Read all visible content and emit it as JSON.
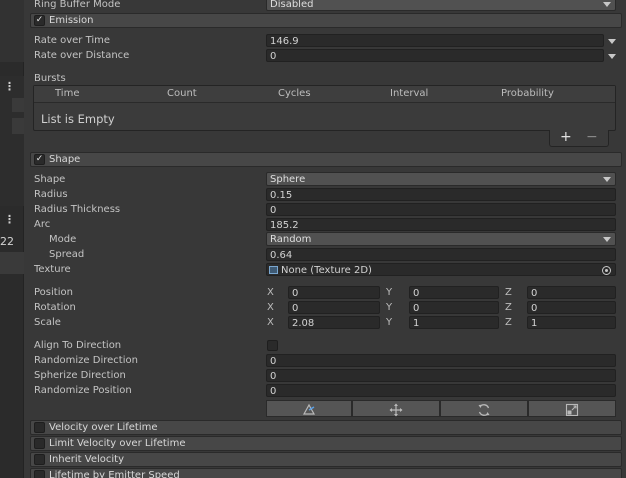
{
  "left_strip": {
    "counter_text": "22"
  },
  "ring_buffer": {
    "label": "Ring Buffer Mode",
    "value": "Disabled"
  },
  "emission": {
    "title": "Emission",
    "rate_over_time": {
      "label": "Rate over Time",
      "value": "146.9"
    },
    "rate_over_distance": {
      "label": "Rate over Distance",
      "value": "0"
    },
    "bursts": {
      "label": "Bursts",
      "columns": [
        "Time",
        "Count",
        "Cycles",
        "Interval",
        "Probability"
      ],
      "empty_text": "List is Empty",
      "add_label": "+",
      "remove_label": "−"
    }
  },
  "shape": {
    "title": "Shape",
    "shape": {
      "label": "Shape",
      "value": "Sphere"
    },
    "radius": {
      "label": "Radius",
      "value": "0.15"
    },
    "radius_thickness": {
      "label": "Radius Thickness",
      "value": "0"
    },
    "arc": {
      "label": "Arc",
      "value": "185.2"
    },
    "mode": {
      "label": "Mode",
      "value": "Random"
    },
    "spread": {
      "label": "Spread",
      "value": "0.64"
    },
    "texture": {
      "label": "Texture",
      "value": "None (Texture 2D)"
    },
    "position": {
      "label": "Position",
      "x": "0",
      "y": "0",
      "z": "0"
    },
    "rotation": {
      "label": "Rotation",
      "x": "0",
      "y": "0",
      "z": "0"
    },
    "scale": {
      "label": "Scale",
      "x": "2.08",
      "y": "1",
      "z": "1"
    },
    "axis_labels": {
      "x": "X",
      "y": "Y",
      "z": "Z"
    },
    "align_to_direction": {
      "label": "Align To Direction",
      "checked": false
    },
    "randomize_direction": {
      "label": "Randomize Direction",
      "value": "0"
    },
    "spherize_direction": {
      "label": "Spherize Direction",
      "value": "0"
    },
    "randomize_position": {
      "label": "Randomize Position",
      "value": "0"
    },
    "tool_icons": [
      "edit-shape-icon",
      "move-icon",
      "rotate-icon",
      "scale-icon"
    ]
  },
  "modules": [
    {
      "title": "Velocity over Lifetime",
      "enabled": false
    },
    {
      "title": "Limit Velocity over Lifetime",
      "enabled": false
    },
    {
      "title": "Inherit Velocity",
      "enabled": false
    },
    {
      "title": "Lifetime by Emitter Speed",
      "enabled": false
    }
  ],
  "colors": {
    "background": "#383838",
    "field": "#2a2a2a",
    "section": "#474747",
    "dropdown": "#515151",
    "text": "#c4c4c4"
  }
}
